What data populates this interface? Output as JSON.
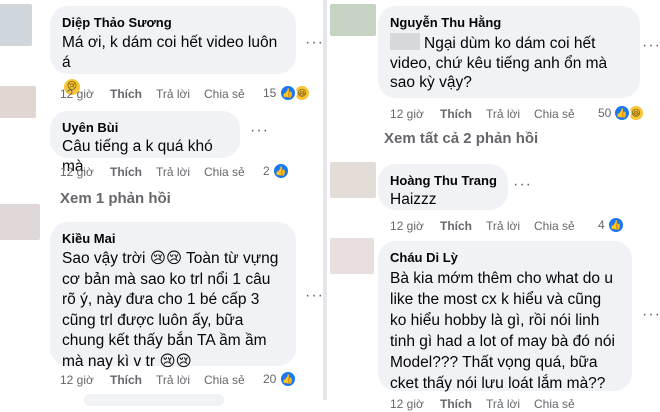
{
  "actions": {
    "time": "12 giờ",
    "like": "Thích",
    "reply": "Trả lời",
    "share": "Chia sẻ"
  },
  "colors": {
    "bubble": "#f0f2f5",
    "meta": "#65676b",
    "like_blue": "#1877f2",
    "divider": "#e4e6eb"
  },
  "left": {
    "comments": [
      {
        "name": "Diệp Thảo Sương",
        "text": "Má ơi, k dám coi hết video luôn á",
        "emoji": "sad",
        "reactions": "15",
        "reaction_icons": [
          "like-icon",
          "haha-icon"
        ]
      },
      {
        "name": "Uyên Bùi",
        "text": "Câu tiếng a k quá khó mà",
        "reactions": "2",
        "reaction_icons": [
          "like-icon"
        ]
      },
      {
        "name": "Kiều Mai",
        "text": "Sao vậy trời 😢😢 Toàn từ vựng cơ bản mà sao ko trl nổi 1 câu rõ ý, này đưa cho 1 bé cấp 3 cũng trl được luôn ấy, bữa chung kết thấy bắn TA ầm ầm mà nay kì v tr 😢😢",
        "reactions": "20",
        "reaction_icons": [
          "like-icon"
        ]
      }
    ],
    "view_replies": "Xem 1 phản hồi"
  },
  "right": {
    "comments": [
      {
        "name": "Nguyễn Thu Hằng",
        "text": "Ngại dùm ko dám coi hết video, chứ kêu tiếng anh ổn mà sao kỳ vậy?",
        "reactions": "50",
        "reaction_icons": [
          "like-icon",
          "haha-icon"
        ]
      },
      {
        "name": "Hoàng Thu Trang",
        "text": "Haizzz",
        "reactions": "4",
        "reaction_icons": [
          "like-icon"
        ]
      },
      {
        "name": "Cháu Di Lỳ",
        "text": "Bà kia mớm thêm cho what do u like the most cx k hiểu và cũng ko hiểu hobby là gì, rồi nói linh tinh gì had a lot of may bà đó nói Model??? Thất vọng quá, bữa cket thấy nói lưu loát lắm mà??"
      }
    ],
    "view_replies": "Xem tất cả 2 phản hồi"
  }
}
